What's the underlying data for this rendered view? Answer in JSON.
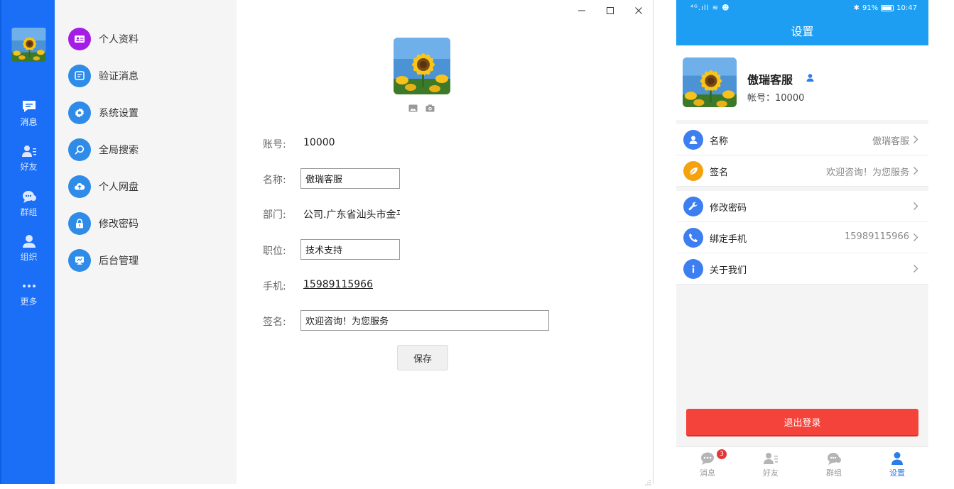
{
  "colors": {
    "rail": "#1a6ff6",
    "mobile_header": "#1d9ef3",
    "logout": "#f4433b",
    "tab_active": "#2b7de9"
  },
  "rail": {
    "items": [
      {
        "label": "消息",
        "icon": "chat-icon"
      },
      {
        "label": "好友",
        "icon": "contacts-icon"
      },
      {
        "label": "群组",
        "icon": "group-icon"
      },
      {
        "label": "组织",
        "icon": "organization-icon"
      },
      {
        "label": "更多",
        "icon": "more-icon"
      }
    ]
  },
  "menu": {
    "items": [
      {
        "label": "个人资料",
        "icon": "id-card-icon"
      },
      {
        "label": "验证消息",
        "icon": "message-icon"
      },
      {
        "label": "系统设置",
        "icon": "gear-icon"
      },
      {
        "label": "全局搜索",
        "icon": "search-icon"
      },
      {
        "label": "个人网盘",
        "icon": "cloud-upload-icon"
      },
      {
        "label": "修改密码",
        "icon": "lock-icon"
      },
      {
        "label": "后台管理",
        "icon": "monitor-icon"
      }
    ]
  },
  "profile": {
    "account_label": "账号:",
    "account": "10000",
    "name_label": "名称:",
    "name": "傲瑞客服",
    "dept_label": "部门:",
    "dept": "公司.广东省汕头市金平区",
    "position_label": "职位:",
    "position": "技术支持",
    "phone_label": "手机:",
    "phone": "15989115966",
    "signature_label": "签名:",
    "signature": "欢迎咨询！为您服务",
    "save_label": "保存"
  },
  "mobile": {
    "status": {
      "left": "⁴ᴳ.ıll ≋ ☻",
      "battery": "91%",
      "time": "10:47"
    },
    "title": "设置",
    "name": "傲瑞客服",
    "account_line": "帐号：10000",
    "rows": [
      {
        "label": "名称",
        "value": "傲瑞客服",
        "icon": "user-icon"
      },
      {
        "label": "签名",
        "value": "欢迎咨询！为您服务",
        "icon": "leaf-icon"
      },
      {
        "label": "修改密码",
        "value": "",
        "icon": "wrench-icon"
      },
      {
        "label": "绑定手机",
        "value": "15989115966",
        "icon": "phone-icon"
      },
      {
        "label": "关于我们",
        "value": "",
        "icon": "info-icon"
      }
    ],
    "logout_label": "退出登录",
    "tabs": [
      {
        "label": "消息",
        "badge": "3",
        "icon": "chat-icon"
      },
      {
        "label": "好友",
        "icon": "contacts-icon"
      },
      {
        "label": "群组",
        "icon": "group-icon"
      },
      {
        "label": "设置",
        "icon": "settings-person-icon"
      }
    ]
  }
}
